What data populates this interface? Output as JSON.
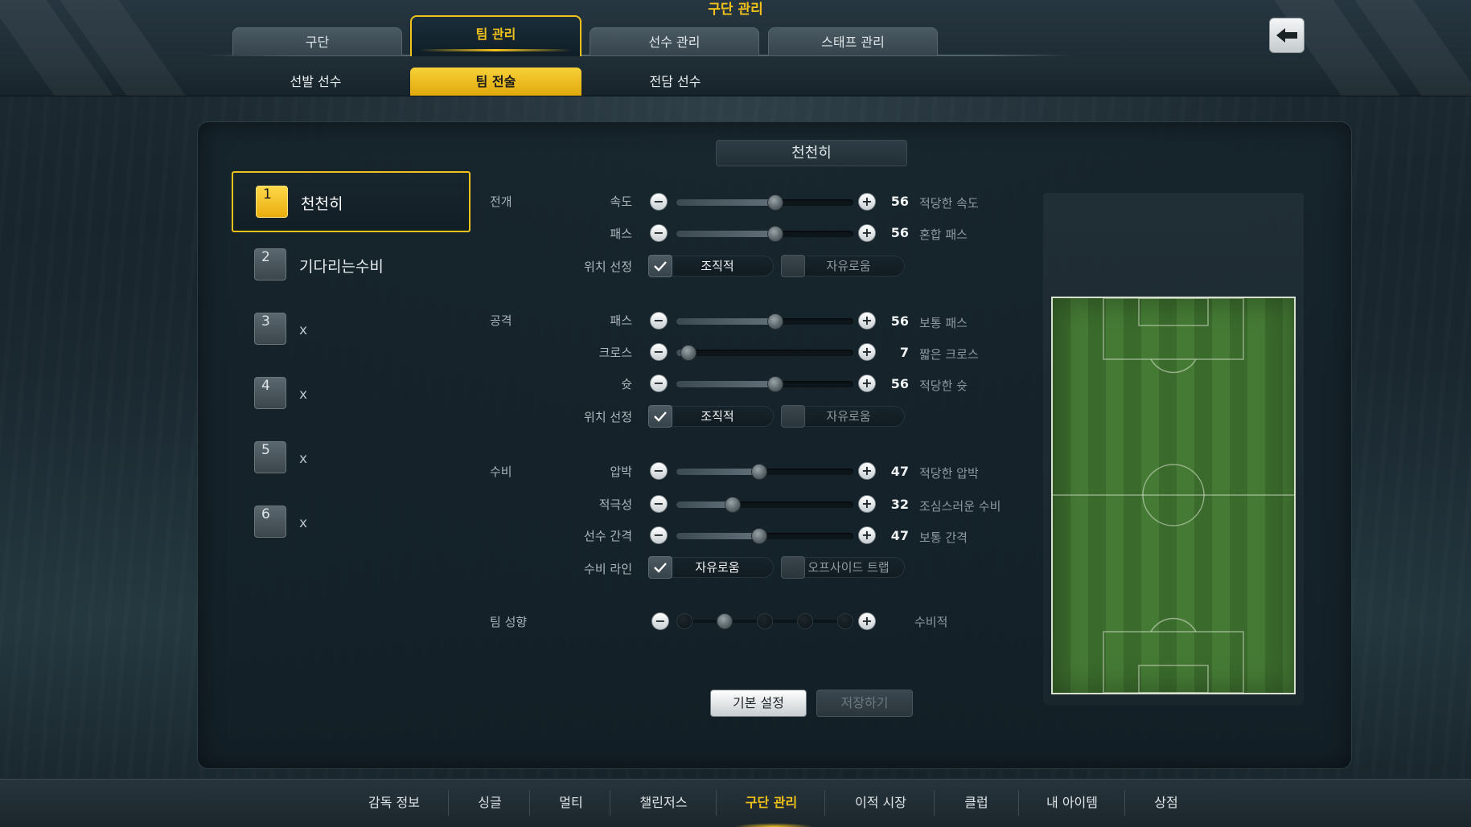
{
  "header": {
    "title": "구단 관리",
    "main_tabs": [
      {
        "label": "구단"
      },
      {
        "label": "팀 관리"
      },
      {
        "label": "선수 관리"
      },
      {
        "label": "스태프 관리"
      }
    ],
    "sub_tabs": [
      {
        "label": "선발 선수"
      },
      {
        "label": "팀 전술"
      },
      {
        "label": "전담 선수"
      }
    ],
    "active_main_tab": "팀 관리",
    "active_sub_tab": "팀 전술",
    "back_icon": "back-arrow-icon"
  },
  "panel_title": "천천히",
  "tactics": [
    {
      "num": "1",
      "name": "천천히",
      "selected": true
    },
    {
      "num": "2",
      "name": "기다리는수비",
      "selected": false
    },
    {
      "num": "3",
      "name": "x",
      "selected": false
    },
    {
      "num": "4",
      "name": "x",
      "selected": false
    },
    {
      "num": "5",
      "name": "x",
      "selected": false
    },
    {
      "num": "6",
      "name": "x",
      "selected": false
    }
  ],
  "sections": {
    "buildup": {
      "label": "전개",
      "speed": {
        "label": "속도",
        "value": "56",
        "desc": "적당한 속도"
      },
      "pass": {
        "label": "패스",
        "value": "56",
        "desc": "혼합 패스"
      },
      "positioning": {
        "label": "위치 선정",
        "option_on": "조직적",
        "option_off": "자유로움"
      }
    },
    "attack": {
      "label": "공격",
      "pass": {
        "label": "패스",
        "value": "56",
        "desc": "보통 패스"
      },
      "cross": {
        "label": "크로스",
        "value": "7",
        "desc": "짧은 크로스"
      },
      "shot": {
        "label": "슛",
        "value": "56",
        "desc": "적당한 슛"
      },
      "positioning": {
        "label": "위치 선정",
        "option_on": "조직적",
        "option_off": "자유로움"
      }
    },
    "defense": {
      "label": "수비",
      "pressure": {
        "label": "압박",
        "value": "47",
        "desc": "적당한 압박"
      },
      "aggression": {
        "label": "적극성",
        "value": "32",
        "desc": "조심스러운 수비"
      },
      "width": {
        "label": "선수 간격",
        "value": "47",
        "desc": "보통 간격"
      },
      "line": {
        "label": "수비 라인",
        "option_on": "자유로움",
        "option_off": "오프사이드 트랩"
      }
    },
    "tendency": {
      "label": "팀 성향",
      "desc": "수비적",
      "level": 2,
      "levels": 5
    }
  },
  "buttons": {
    "default": "기본 설정",
    "save": "저장하기"
  },
  "bottom_nav": [
    {
      "label": "감독 정보"
    },
    {
      "label": "싱글"
    },
    {
      "label": "멀티"
    },
    {
      "label": "챌린저스"
    },
    {
      "label": "구단 관리"
    },
    {
      "label": "이적 시장"
    },
    {
      "label": "클럽"
    },
    {
      "label": "내 아이템"
    },
    {
      "label": "상점"
    }
  ],
  "colors": {
    "accent": "#f2c21c",
    "panel": "#16242c",
    "pitch": "#3f7230"
  }
}
